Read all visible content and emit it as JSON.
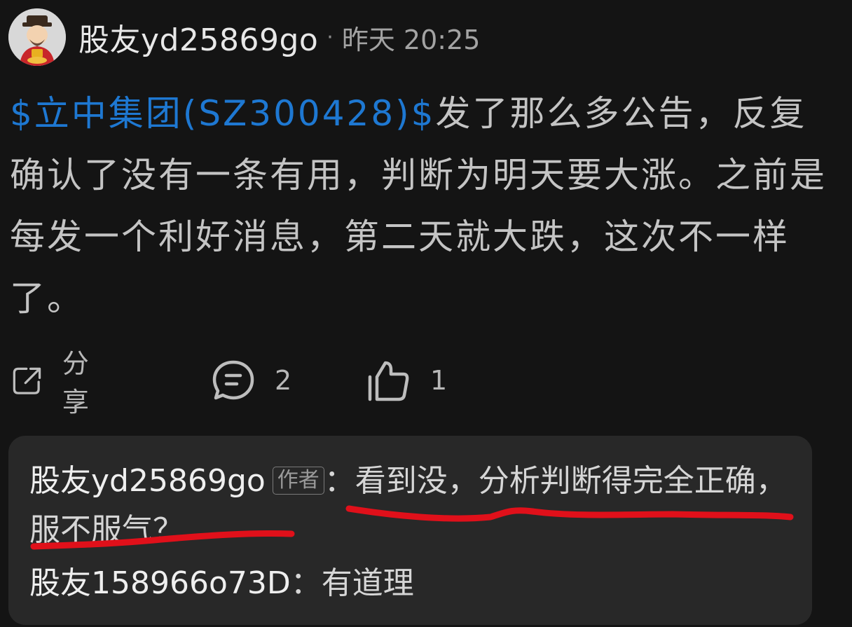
{
  "post": {
    "author_name": "股友yd25869go",
    "separator": "·",
    "time": "昨天 20:25",
    "stock_tag": "$立中集团(SZ300428)$",
    "text": "发了那么多公告，反复确认了没有一条有用，判断为明天要大涨。之前是每发一个利好消息，第二天就大跌，这次不一样了。"
  },
  "actions": {
    "share_label": "分享",
    "comment_count": "2",
    "like_count": "1",
    "icons": [
      "share-icon",
      "comment-icon",
      "like-icon"
    ]
  },
  "comments": [
    {
      "user": "股友yd25869go",
      "tag": "作者",
      "text": "：看到没，分析判断得完全正确，服不服气？"
    },
    {
      "user": "股友158966o73D",
      "text": "：有道理"
    }
  ],
  "colors": {
    "background": "#141414",
    "stock_link": "#1e78d2",
    "underline": "#e0101a",
    "comment_box": "#282828"
  }
}
